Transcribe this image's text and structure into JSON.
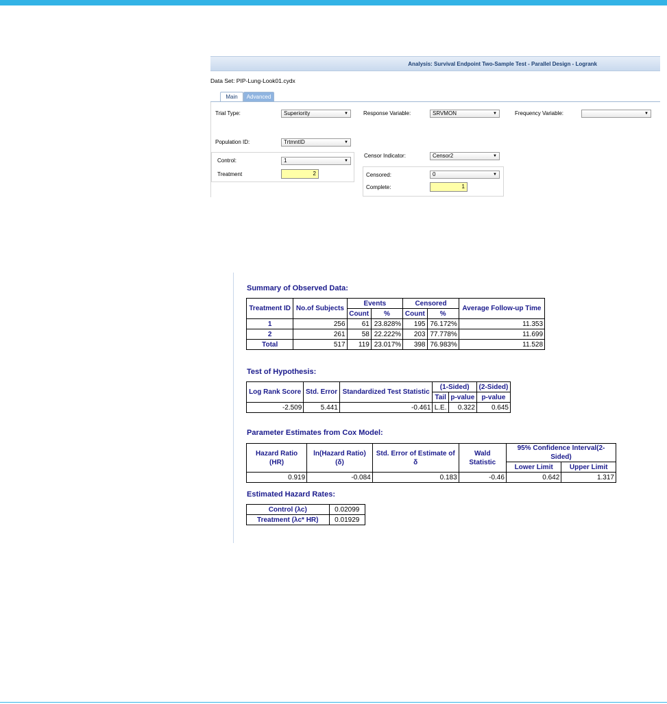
{
  "dialog": {
    "title": "Analysis: Survival Endpoint Two-Sample Test - Parallel Design - Logrank",
    "dataset": "Data Set: PIP-Lung-Look01.cydx",
    "tabs": [
      "Main",
      "Advanced"
    ],
    "trial_type_label": "Trial Type:",
    "trial_type_value": "Superiority",
    "response_variable_label": "Response Variable:",
    "response_variable_value": "SRVMON",
    "frequency_variable_label": "Frequency Variable:",
    "frequency_variable_value": "",
    "population_id_label": "Population ID:",
    "population_id_value": "TrtmntID",
    "control_label": "Control:",
    "control_value": "1",
    "treatment_label": "Treatment",
    "treatment_value": "2",
    "censor_indicator_label": "Censor Indicator:",
    "censor_indicator_value": "Censor2",
    "censored_label": "Censored:",
    "censored_value": "0",
    "complete_label": "Complete:",
    "complete_value": "1"
  },
  "report": {
    "summary_title": "Summary of Observed Data:",
    "summary_headers": {
      "treatment_id": "Treatment ID",
      "no_of_subjects": "No.of Subjects",
      "events": "Events",
      "censored": "Censored",
      "avg_followup": "Average Follow-up Time",
      "count": "Count",
      "pct": "%"
    },
    "summary_rows": [
      [
        "1",
        "256",
        "61",
        "23.828%",
        "195",
        "76.172%",
        "11.353"
      ],
      [
        "2",
        "261",
        "58",
        "22.222%",
        "203",
        "77.778%",
        "11.699"
      ],
      [
        "Total",
        "517",
        "119",
        "23.017%",
        "398",
        "76.983%",
        "11.528"
      ]
    ],
    "hypothesis_title": "Test of Hypothesis:",
    "hypothesis_headers": {
      "log_rank": "Log Rank Score",
      "std_error": "Std. Error",
      "std_stat": "Standardized Test Statistic",
      "one_sided": "(1-Sided)",
      "two_sided": "(2-Sided)",
      "tail": "Tail",
      "pvalue": "p-value"
    },
    "hypothesis_row": [
      "-2.509",
      "5.441",
      "-0.461",
      "L.E.",
      "0.322",
      "0.645"
    ],
    "cox_title": "Parameter Estimates from Cox Model:",
    "cox_headers": {
      "hr": "Hazard Ratio (HR)",
      "ln_hr": "ln(Hazard Ratio) (δ)",
      "se": "Std. Error of Estimate of δ",
      "wald": "Wald Statistic",
      "ci": "95% Confidence Interval(2-Sided)",
      "lower": "Lower Limit",
      "upper": "Upper Limit"
    },
    "cox_row": [
      "0.919",
      "-0.084",
      "0.183",
      "-0.46",
      "0.642",
      "1.317"
    ],
    "hazard_title": "Estimated Hazard Rates:",
    "hazard_rows": [
      [
        "Control (λc)",
        "0.02099"
      ],
      [
        "Treatment (λc* HR)",
        "0.01929"
      ]
    ]
  }
}
